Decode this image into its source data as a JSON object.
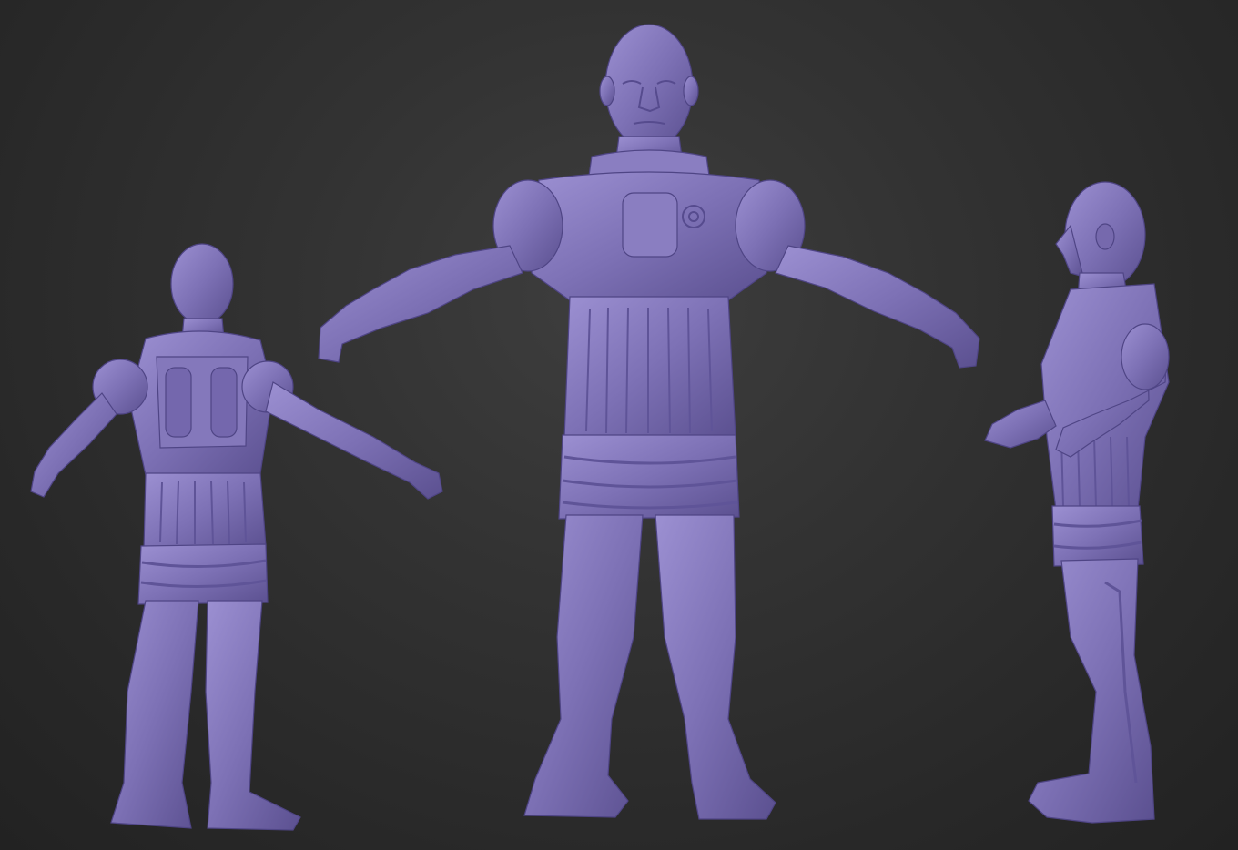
{
  "scene": {
    "background_color": "#333333",
    "model_color": "#7e72b6",
    "views": [
      {
        "name": "back",
        "icon": "figure-back-view"
      },
      {
        "name": "front",
        "icon": "figure-front-view"
      },
      {
        "name": "side",
        "icon": "figure-side-view"
      }
    ]
  }
}
